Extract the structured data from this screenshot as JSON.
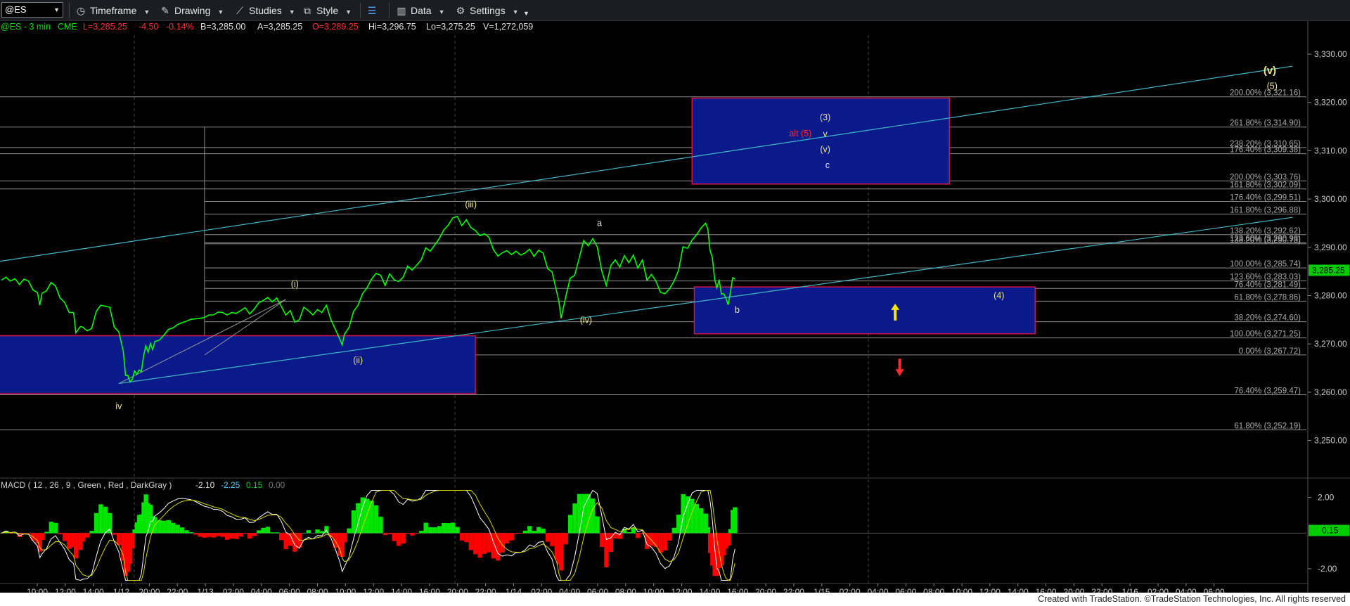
{
  "toolbar": {
    "symbol": "@ES",
    "timeframe_label": "Timeframe",
    "drawing_label": "Drawing",
    "studies_label": "Studies",
    "style_label": "Style",
    "data_label": "Data",
    "settings_label": "Settings"
  },
  "quote": {
    "name": "@ES - 3 min",
    "exchange": "CME",
    "last": "L=3,285.25",
    "change": "-4.50",
    "pct": "-0.14%",
    "bid": "B=3,285.00",
    "ask": "A=3,285.25",
    "open": "O=3,289.25",
    "high": "Hi=3,296.75",
    "low": "Lo=3,275.25",
    "volume": "V=1,272,059"
  },
  "colors": {
    "price": "#00ff00",
    "axis_text": "#cccccc",
    "box_fill": "#0a1a8a",
    "box_border": "#d0154a",
    "trendline": "#3fb9c7",
    "fib_line": "#8c8c8c",
    "wave_yellow": "#f0e68c",
    "wave_red": "#ff2a2a",
    "macd_pos": "#00e600",
    "macd_neg": "#ff0000",
    "macd_line": "#ffffff",
    "signal_line": "#d7d700",
    "last_price_bg": "#00cc00"
  },
  "chart_data": {
    "type": "candlestick-line",
    "y_axis": {
      "min": 3243,
      "max": 3333,
      "ticks": [
        "3,330.00",
        "3,320.00",
        "3,310.00",
        "3,300.00",
        "3,290.00",
        "3,280.00",
        "3,270.00",
        "3,260.00",
        "3,250.00"
      ],
      "tick_values": [
        3330,
        3320,
        3310,
        3300,
        3290,
        3280,
        3270,
        3260,
        3250
      ]
    },
    "x_axis": {
      "ticks": [
        "10:00",
        "12:00",
        "14:00",
        "1/12",
        "20:00",
        "22:00",
        "1/13",
        "02:00",
        "04:00",
        "06:00",
        "08:00",
        "10:00",
        "12:00",
        "14:00",
        "16:00",
        "20:00",
        "22:00",
        "1/14",
        "02:00",
        "04:00",
        "06:00",
        "08:00",
        "10:00",
        "12:00",
        "14:00",
        "16:00",
        "20:00",
        "22:00",
        "1/15",
        "02:00",
        "04:00",
        "06:00",
        "08:00",
        "10:00",
        "12:00",
        "14:00",
        "16:00",
        "20:00",
        "22:00",
        "1/16",
        "02:00",
        "04:00",
        "06:00"
      ]
    },
    "last_price": "3,285.25",
    "price_path": [
      [
        0,
        3283.2
      ],
      [
        2,
        3283.8
      ],
      [
        4,
        3283
      ],
      [
        6,
        3283.5
      ],
      [
        8,
        3282.3
      ],
      [
        10,
        3283.4
      ],
      [
        12,
        3283
      ],
      [
        14,
        3281.2
      ],
      [
        16,
        3280.6
      ],
      [
        17,
        3278
      ],
      [
        18,
        3280.5
      ],
      [
        20,
        3281
      ],
      [
        22,
        3282.7
      ],
      [
        24,
        3282
      ],
      [
        26,
        3279.5
      ],
      [
        28,
        3278.6
      ],
      [
        30,
        3276.5
      ],
      [
        32,
        3276.5
      ],
      [
        33,
        3272.3
      ],
      [
        35,
        3273.6
      ],
      [
        36,
        3273.5
      ],
      [
        38,
        3272.7
      ],
      [
        40,
        3273.2
      ],
      [
        42,
        3276.7
      ],
      [
        44,
        3278
      ],
      [
        46,
        3277.8
      ],
      [
        48,
        3277.6
      ],
      [
        50,
        3273.5
      ],
      [
        52,
        3272.5
      ],
      [
        54,
        3268.5
      ],
      [
        55,
        3263.5
      ],
      [
        56,
        3263.5
      ],
      [
        57,
        3262.1
      ],
      [
        58,
        3262.7
      ],
      [
        59,
        3264.4
      ],
      [
        60,
        3263.7
      ],
      [
        61,
        3264.6
      ],
      [
        62,
        3264.2
      ],
      [
        63,
        3267.5
      ],
      [
        64,
        3269.6
      ],
      [
        65,
        3268.3
      ],
      [
        66,
        3270.1
      ],
      [
        67,
        3268.8
      ],
      [
        68,
        3270.5
      ],
      [
        70,
        3270.8
      ],
      [
        72,
        3271.8
      ],
      [
        74,
        3273
      ],
      [
        76,
        3273.3
      ],
      [
        78,
        3274
      ],
      [
        80,
        3274.4
      ],
      [
        82,
        3274.7
      ],
      [
        84,
        3275.1
      ],
      [
        86,
        3275.2
      ],
      [
        88,
        3275.3
      ],
      [
        90,
        3275.5
      ],
      [
        92,
        3276
      ],
      [
        94,
        3276
      ],
      [
        96,
        3276.6
      ],
      [
        98,
        3276.5
      ],
      [
        100,
        3276
      ],
      [
        102,
        3276.5
      ],
      [
        104,
        3276.3
      ],
      [
        106,
        3276.9
      ],
      [
        108,
        3277.5
      ],
      [
        110,
        3276.2
      ],
      [
        112,
        3277.2
      ],
      [
        114,
        3278.5
      ],
      [
        116,
        3279
      ],
      [
        118,
        3279.6
      ],
      [
        120,
        3278.7
      ],
      [
        122,
        3279.5
      ],
      [
        124,
        3277.8
      ],
      [
        126,
        3276
      ],
      [
        128,
        3276.9
      ],
      [
        130,
        3274.5
      ],
      [
        132,
        3275
      ],
      [
        134,
        3277.6
      ],
      [
        136,
        3276.9
      ],
      [
        138,
        3276
      ],
      [
        140,
        3277.1
      ],
      [
        142,
        3276.5
      ],
      [
        144,
        3278
      ],
      [
        146,
        3275
      ],
      [
        148,
        3273
      ],
      [
        150,
        3270.9
      ],
      [
        151,
        3269.8
      ],
      [
        152,
        3272
      ],
      [
        154,
        3273.4
      ],
      [
        156,
        3276.7
      ],
      [
        158,
        3278
      ],
      [
        160,
        3280.4
      ],
      [
        162,
        3281.6
      ],
      [
        164,
        3283.4
      ],
      [
        166,
        3284.6
      ],
      [
        168,
        3284.2
      ],
      [
        170,
        3282.1
      ],
      [
        172,
        3284.5
      ],
      [
        174,
        3283.3
      ],
      [
        176,
        3282.9
      ],
      [
        178,
        3283.8
      ],
      [
        180,
        3286.1
      ],
      [
        182,
        3285.3
      ],
      [
        184,
        3286.3
      ],
      [
        186,
        3287.4
      ],
      [
        188,
        3289.9
      ],
      [
        190,
        3289.2
      ],
      [
        192,
        3290.5
      ],
      [
        194,
        3291.8
      ],
      [
        196,
        3293.6
      ],
      [
        198,
        3294.6
      ],
      [
        200,
        3296.1
      ],
      [
        202,
        3296.4
      ],
      [
        204,
        3294.5
      ],
      [
        206,
        3295.7
      ],
      [
        208,
        3294.1
      ],
      [
        210,
        3293.5
      ],
      [
        212,
        3292.4
      ],
      [
        214,
        3292.8
      ],
      [
        216,
        3292.1
      ],
      [
        218,
        3289.5
      ],
      [
        220,
        3288.2
      ],
      [
        222,
        3288.9
      ],
      [
        224,
        3289.3
      ],
      [
        226,
        3288.5
      ],
      [
        228,
        3289.2
      ],
      [
        230,
        3288.4
      ],
      [
        232,
        3288.8
      ],
      [
        234,
        3289.6
      ],
      [
        236,
        3288.1
      ],
      [
        238,
        3289.4
      ],
      [
        240,
        3288.8
      ],
      [
        242,
        3285.6
      ],
      [
        244,
        3284.9
      ],
      [
        246,
        3280.8
      ],
      [
        247,
        3278.8
      ],
      [
        248,
        3275.3
      ],
      [
        250,
        3279.7
      ],
      [
        252,
        3283.6
      ],
      [
        254,
        3284.2
      ],
      [
        256,
        3287.8
      ],
      [
        258,
        3291.4
      ],
      [
        260,
        3290.3
      ],
      [
        262,
        3291.8
      ],
      [
        264,
        3290.1
      ],
      [
        266,
        3285.1
      ],
      [
        268,
        3282.1
      ],
      [
        270,
        3286.2
      ],
      [
        272,
        3287.4
      ],
      [
        274,
        3285.9
      ],
      [
        276,
        3288.3
      ],
      [
        278,
        3286.8
      ],
      [
        280,
        3288.4
      ],
      [
        282,
        3285.7
      ],
      [
        284,
        3287.4
      ],
      [
        286,
        3283.2
      ],
      [
        288,
        3284.4
      ],
      [
        290,
        3283
      ],
      [
        292,
        3280.7
      ],
      [
        294,
        3280.4
      ],
      [
        296,
        3281.4
      ],
      [
        298,
        3283
      ],
      [
        300,
        3285.2
      ],
      [
        302,
        3290.1
      ],
      [
        304,
        3289.8
      ],
      [
        306,
        3291.5
      ],
      [
        308,
        3292.6
      ],
      [
        310,
        3294
      ],
      [
        312,
        3295
      ],
      [
        313,
        3293.8
      ],
      [
        314,
        3289.3
      ],
      [
        315,
        3287.9
      ],
      [
        316,
        3283.4
      ],
      [
        317,
        3281.6
      ],
      [
        318,
        3283.3
      ],
      [
        319,
        3280.3
      ],
      [
        320,
        3280.4
      ],
      [
        321,
        3279.5
      ],
      [
        322,
        3278.1
      ],
      [
        323,
        3280.7
      ],
      [
        324,
        3283.7
      ],
      [
        325,
        3283.4
      ]
    ],
    "fib_levels": [
      {
        "label": "200.00% (3,321.16)",
        "value": 3321.16
      },
      {
        "label": "261.80% (3,314.90)",
        "value": 3314.9
      },
      {
        "label": "238.20% (3,310.65)",
        "value": 3310.65
      },
      {
        "label": "176.40% (3,309.38)",
        "value": 3309.38
      },
      {
        "label": "200.00% (3,303.76)",
        "value": 3303.76
      },
      {
        "label": "161.80% (3,302.09)",
        "value": 3302.09
      },
      {
        "label": "176.40% (3,299.51)",
        "value": 3299.51
      },
      {
        "label": "161.80% (3,296.88)",
        "value": 3296.88
      },
      {
        "label": "138.20% (3,292.62)",
        "value": 3292.62
      },
      {
        "label": "123.60% (3,290.98)",
        "value": 3290.98
      },
      {
        "label": "138.20% (3,290.73)",
        "value": 3290.73
      },
      {
        "label": "100.00% (3,285.74)",
        "value": 3285.74
      },
      {
        "label": "123.60% (3,283.03)",
        "value": 3283.03
      },
      {
        "label": "76.40% (3,281.49)",
        "value": 3281.49
      },
      {
        "label": "61.80% (3,278.86)",
        "value": 3278.86
      },
      {
        "label": "38.20% (3,274.60)",
        "value": 3274.6
      },
      {
        "label": "100.00% (3,271.25)",
        "value": 3271.25
      },
      {
        "label": "0.00% (3,267.72)",
        "value": 3267.72
      },
      {
        "label": "76.40% (3,259.47)",
        "value": 3259.47
      },
      {
        "label": "61.80% (3,252.19)",
        "value": 3252.19
      }
    ],
    "boxes": [
      {
        "name": "box-target-upper",
        "t0": 306,
        "t1": 420,
        "top": 3320.9,
        "bottom": 3303.1
      },
      {
        "name": "box-support-4",
        "t0": 307,
        "t1": 458,
        "top": 3281.8,
        "bottom": 3272.1
      },
      {
        "name": "box-support-left",
        "t0": -5,
        "t1": 210,
        "top": 3271.7,
        "bottom": 3259.7
      }
    ],
    "trendlines": [
      {
        "t0": -5,
        "v0": 3286.8,
        "t1": 572,
        "v1": 3327.5
      },
      {
        "t0": 52,
        "v0": 3261.8,
        "t1": 572,
        "v1": 3296.2
      }
    ],
    "wave_labels": [
      {
        "text": "iv",
        "t": 52,
        "v": 3256.5,
        "color": "yellow"
      },
      {
        "text": "(i)",
        "t": 130,
        "v": 3281.8,
        "color": "yellow"
      },
      {
        "text": "(ii)",
        "t": 158,
        "v": 3266,
        "color": "yellow"
      },
      {
        "text": "(iii)",
        "t": 208,
        "v": 3298.3,
        "color": "yellow"
      },
      {
        "text": "(iv)",
        "t": 259,
        "v": 3274.3,
        "color": "yellow"
      },
      {
        "text": "a",
        "t": 265,
        "v": 3294.4,
        "color": "white"
      },
      {
        "text": "b",
        "t": 326,
        "v": 3276.4,
        "color": "white"
      },
      {
        "text": "(3)",
        "t": 365,
        "v": 3316.3,
        "color": "yellow"
      },
      {
        "text": "alt (5)",
        "t": 354,
        "v": 3313,
        "color": "red"
      },
      {
        "text": "v",
        "t": 365,
        "v": 3312.9,
        "color": "yellow"
      },
      {
        "text": "(v)",
        "t": 365,
        "v": 3309.7,
        "color": "yellow"
      },
      {
        "text": "c",
        "t": 366,
        "v": 3306.4,
        "color": "white"
      },
      {
        "text": "(4)",
        "t": 442,
        "v": 3279.4,
        "color": "yellow"
      },
      {
        "text": "(v)",
        "t": 562,
        "v": 3325.9,
        "color": "yellow",
        "big": true
      },
      {
        "text": "(5)",
        "t": 563,
        "v": 3322.8,
        "color": "yellow"
      }
    ],
    "arrows": [
      {
        "dir": "up",
        "t": 396,
        "v": 3276.6,
        "color": "yellow"
      },
      {
        "dir": "down",
        "t": 398,
        "v": 3265.2,
        "color": "red"
      }
    ],
    "macd": {
      "label": "MACD ( 12 , 26 , 9 , Green , Red , DarkGray )",
      "macd_value": "-2.10",
      "signal_value": "-2.25",
      "hist_value": "0.15",
      "zero_value": "0.00",
      "y_min": -2.75,
      "y_max": 2.5,
      "ticks": [
        "2.00",
        "-2.00"
      ],
      "tick_values": [
        2,
        -2
      ],
      "current": "0.15"
    },
    "watermark": ""
  },
  "footer": {
    "credit": "Created with TradeStation. ©TradeStation Technologies, Inc. All rights reserved"
  }
}
